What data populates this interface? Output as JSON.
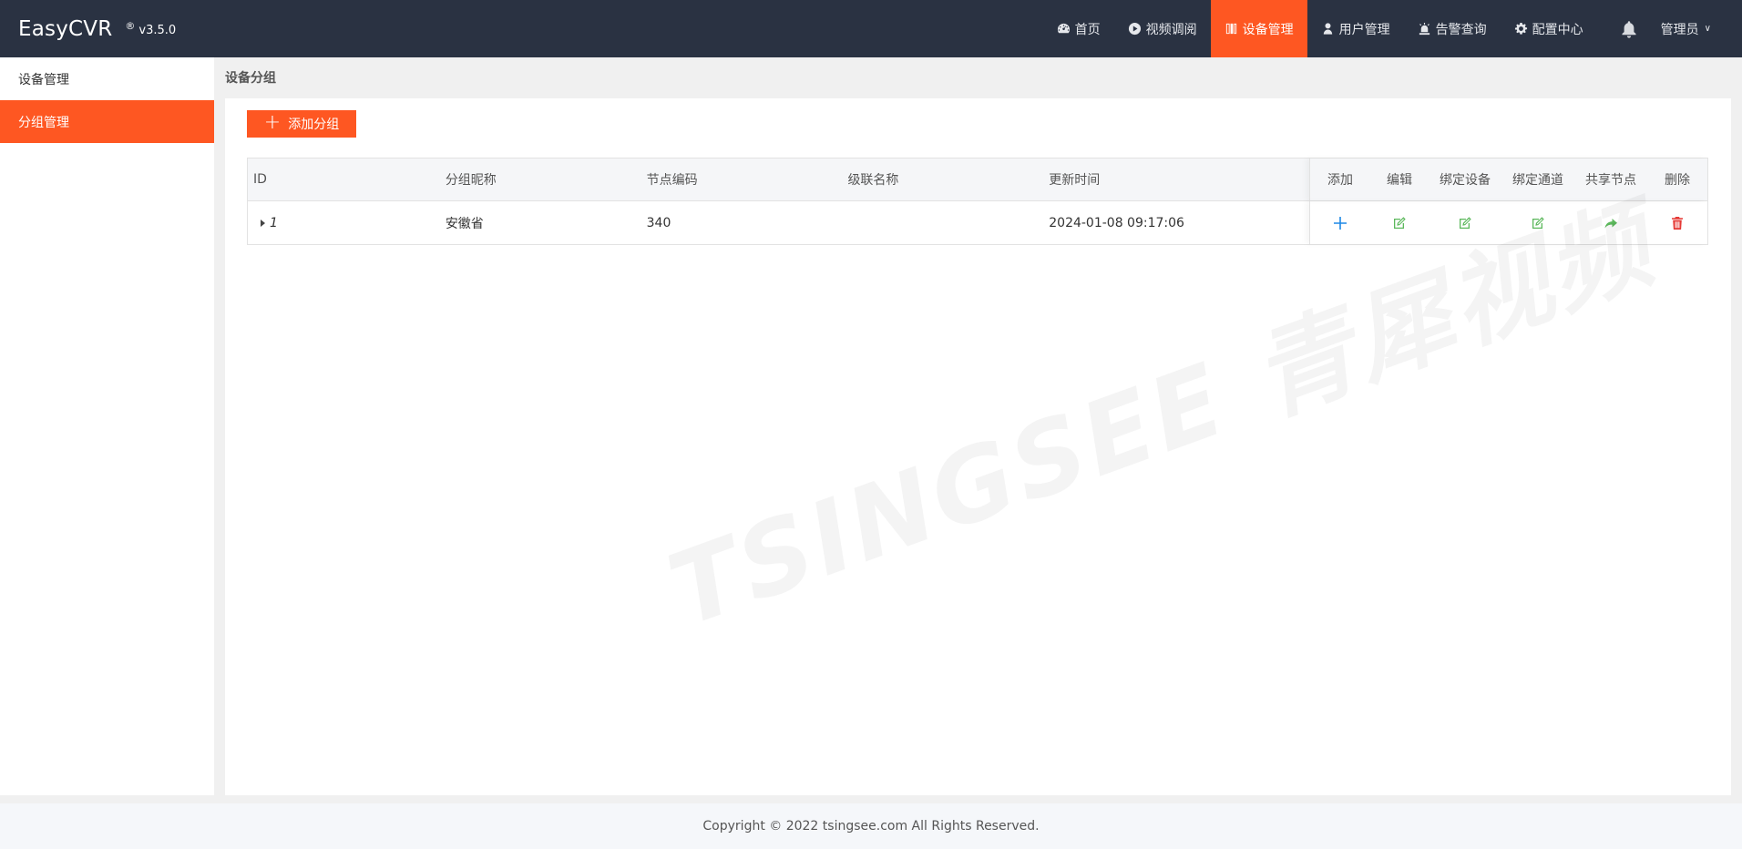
{
  "brand": {
    "name": "EasyCVR",
    "reg": "®",
    "version": "v3.5.0"
  },
  "nav": {
    "items": [
      {
        "label": "首页",
        "icon": "dashboard-icon"
      },
      {
        "label": "视频调阅",
        "icon": "play-circle-icon"
      },
      {
        "label": "设备管理",
        "icon": "columns-icon",
        "active": true
      },
      {
        "label": "用户管理",
        "icon": "user-icon"
      },
      {
        "label": "告警查询",
        "icon": "alarm-light-icon"
      },
      {
        "label": "配置中心",
        "icon": "gear-icon"
      }
    ],
    "user": "管理员"
  },
  "sidebar": {
    "items": [
      {
        "label": "设备管理"
      },
      {
        "label": "分组管理",
        "active": true
      }
    ]
  },
  "breadcrumb": "设备分组",
  "toolbar": {
    "add_label": "添加分组"
  },
  "table": {
    "headers": {
      "id": "ID",
      "name": "分组昵称",
      "code": "节点编码",
      "cascade": "级联名称",
      "time": "更新时间",
      "add": "添加",
      "edit": "编辑",
      "bind_device": "绑定设备",
      "bind_channel": "绑定通道",
      "share": "共享节点",
      "delete": "删除"
    },
    "rows": [
      {
        "id": "1",
        "name": "安徽省",
        "code": "340",
        "cascade": "",
        "time": "2024-01-08 09:17:06"
      }
    ]
  },
  "watermark": "TSINGSEE 青犀视频",
  "footer": "Copyright © 2022 tsingsee.com All Rights Reserved.",
  "colors": {
    "topbar": "#2a3242",
    "accent": "#fe5722",
    "add_icon": "#1e88e5",
    "edit_icon": "#5cb85c",
    "delete_icon": "#e53935"
  }
}
